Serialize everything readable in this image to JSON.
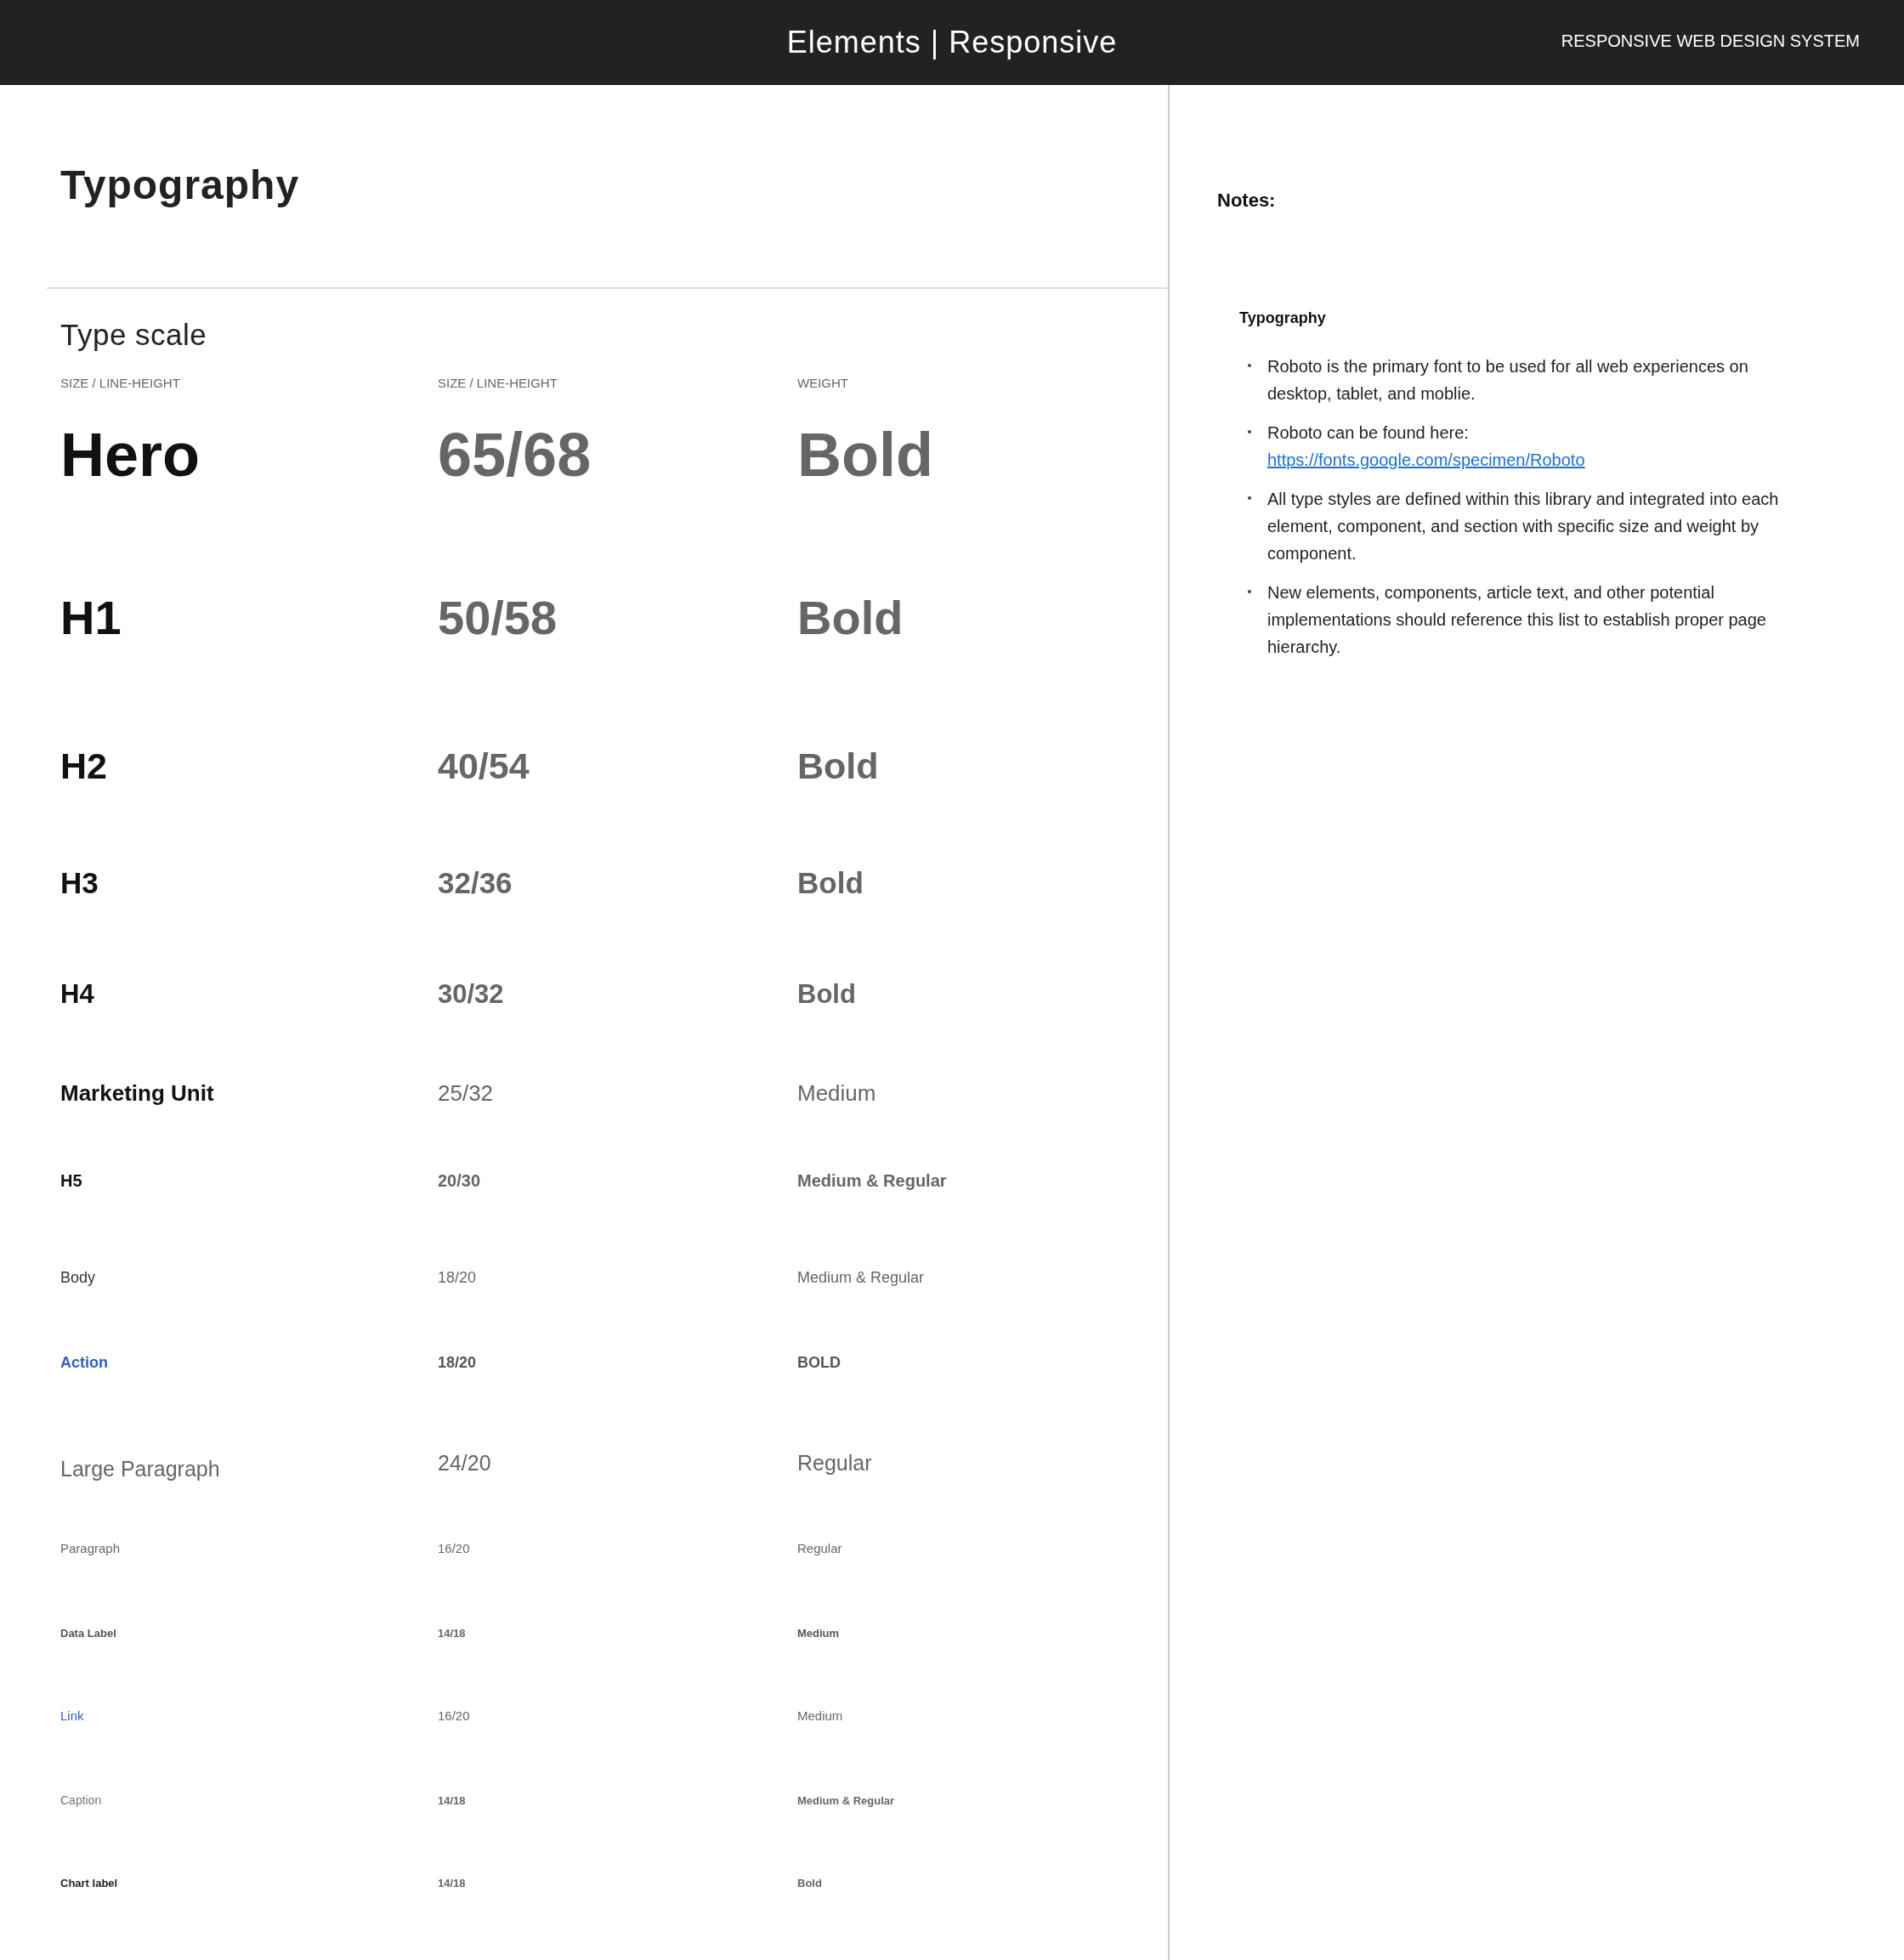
{
  "header": {
    "title": "Elements | Responsive",
    "system_name": "RESPONSIVE WEB DESIGN SYSTEM"
  },
  "main": {
    "title": "Typography",
    "section_title": "Type scale",
    "columns": [
      "SIZE / LINE-HEIGHT",
      "SIZE / LINE-HEIGHT",
      "WEIGHT"
    ],
    "rows": [
      {
        "kind": "hero",
        "name": "Hero",
        "size": "65/68",
        "weight": "Bold"
      },
      {
        "kind": "h1",
        "name": "H1",
        "size": "50/58",
        "weight": "Bold"
      },
      {
        "kind": "h2",
        "name": "H2",
        "size": "40/54",
        "weight": "Bold"
      },
      {
        "kind": "h3",
        "name": "H3",
        "size": "32/36",
        "weight": "Bold"
      },
      {
        "kind": "h4",
        "name": "H4",
        "size": "30/32",
        "weight": "Bold"
      },
      {
        "kind": "marketing",
        "name": "Marketing Unit",
        "size": "25/32",
        "weight": "Medium"
      },
      {
        "kind": "h5",
        "name": "H5",
        "size": "20/30",
        "weight": "Medium & Regular"
      },
      {
        "kind": "body",
        "name": "Body",
        "size": "18/20",
        "weight": "Medium & Regular"
      },
      {
        "kind": "action",
        "name": "Action",
        "size": "18/20",
        "weight": "BOLD"
      },
      {
        "kind": "large",
        "name": "Large Paragraph",
        "size": "24/20",
        "weight": "Regular"
      },
      {
        "kind": "paragraph",
        "name": "Paragraph",
        "size": "16/20",
        "weight": "Regular"
      },
      {
        "kind": "datalabel",
        "name": "Data Label",
        "size": "14/18",
        "weight": "Medium"
      },
      {
        "kind": "link",
        "name": "Link",
        "size": "16/20",
        "weight": "Medium"
      },
      {
        "kind": "caption",
        "name": "Caption",
        "size": "14/18",
        "weight": "Medium & Regular"
      },
      {
        "kind": "chart",
        "name": "Chart label",
        "size": "14/18",
        "weight": "Bold"
      }
    ]
  },
  "notes": {
    "title": "Notes:",
    "subtitle": "Typography",
    "items": [
      {
        "text": "Roboto is the primary font to be used for all web experiences on desktop, tablet, and moblie."
      },
      {
        "text": "Roboto can be found here:",
        "link": "https://fonts.google.com/specimen/Roboto"
      },
      {
        "text": "All type styles are defined within this library and integrated into each element, component, and section with specific size and weight by component."
      },
      {
        "text": "New elements, components, article text, and other potential implementations should reference this list to establish proper page hierarchy."
      }
    ]
  }
}
